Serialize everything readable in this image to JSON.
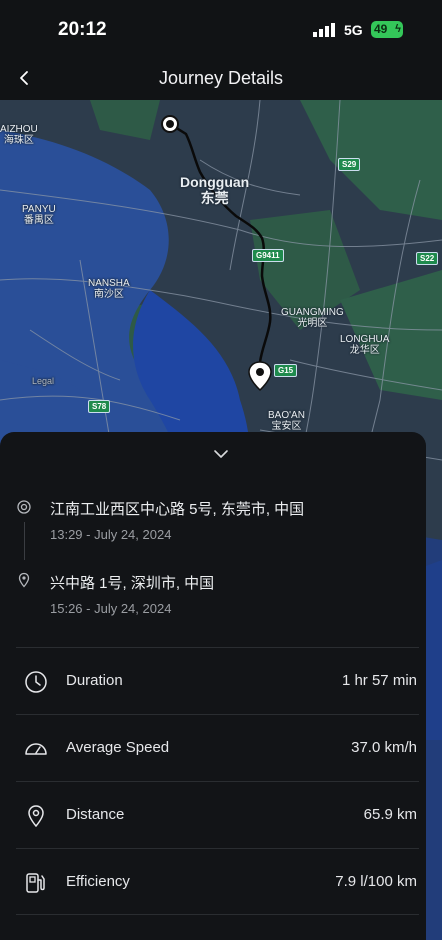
{
  "status_bar": {
    "time": "20:12",
    "network": "5G",
    "battery": "49"
  },
  "nav": {
    "title": "Journey Details"
  },
  "map": {
    "labels": {
      "dongguan_en": "Dongguan",
      "dongguan_zh": "东莞",
      "panyu_en": "PANYU",
      "panyu_zh": "番禺区",
      "nansha_en": "NANSHA",
      "nansha_zh": "南沙区",
      "guangming_en": "GUANGMING",
      "guangming_zh": "光明区",
      "longhua_en": "LONGHUA",
      "longhua_zh": "龙华区",
      "baoan_en": "BAO'AN",
      "baoan_zh": "宝安区",
      "aizhou_en": "AIZHOU",
      "aizhou_zh": "海珠区",
      "legal": "Legal"
    },
    "shields": [
      "S29",
      "G9411",
      "S22",
      "G15",
      "S78"
    ]
  },
  "journey": {
    "start": {
      "address": "江南工业西区中心路 5号, 东莞市, 中国",
      "time": "13:29 - July 24, 2024"
    },
    "end": {
      "address": "兴中路 1号, 深圳市, 中国",
      "time": "15:26 - July 24, 2024"
    }
  },
  "stats": [
    {
      "icon": "clock-icon",
      "label": "Duration",
      "value": "1 hr 57 min"
    },
    {
      "icon": "speedometer-icon",
      "label": "Average Speed",
      "value": "37.0 km/h"
    },
    {
      "icon": "location-pin-icon",
      "label": "Distance",
      "value": "65.9 km"
    },
    {
      "icon": "fuel-pump-icon",
      "label": "Efficiency",
      "value": "7.9 l/100 km"
    }
  ],
  "colors": {
    "background": "#0d0f12",
    "sheet": "#121417",
    "map_water": "#1f3f8a",
    "map_land": "#2b3a4a",
    "map_green": "#2f6b4e",
    "battery": "#34c759"
  }
}
